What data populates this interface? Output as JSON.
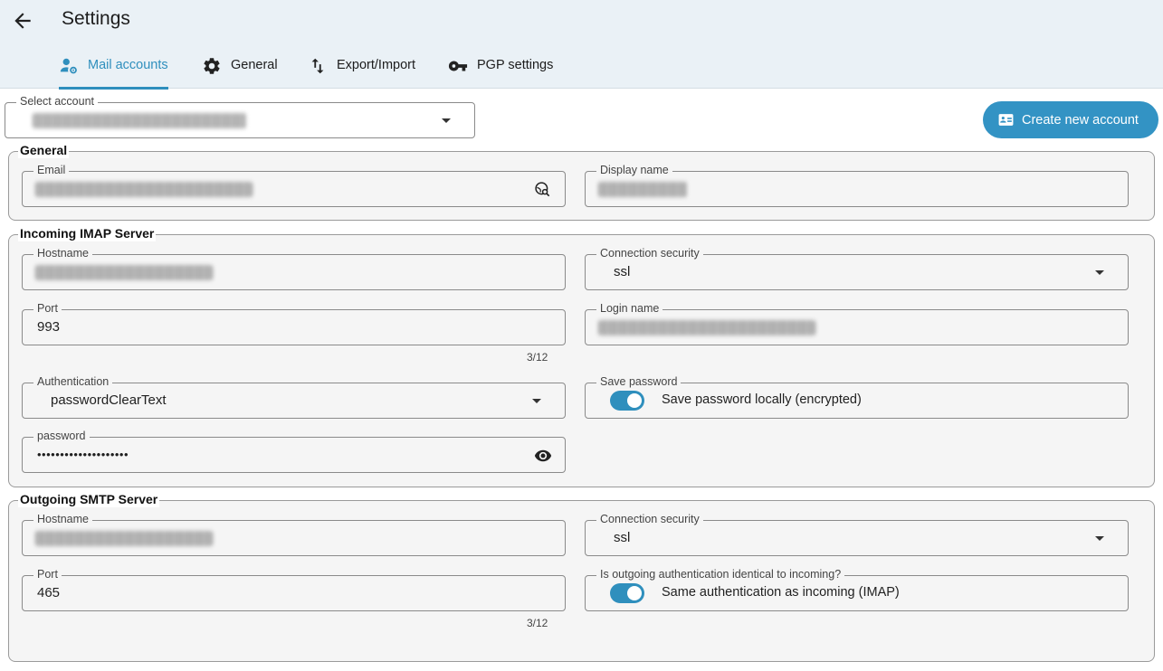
{
  "header": {
    "title": "Settings"
  },
  "tabs": [
    {
      "label": "Mail accounts",
      "icon": "manage-accounts-icon",
      "active": true
    },
    {
      "label": "General",
      "icon": "gear-icon",
      "active": false
    },
    {
      "label": "Export/Import",
      "icon": "swap-vert-icon",
      "active": false
    },
    {
      "label": "PGP settings",
      "icon": "key-icon",
      "active": false
    }
  ],
  "account_select": {
    "label": "Select account"
  },
  "create_button": {
    "label": "Create new account",
    "icon": "contact-card-icon"
  },
  "general": {
    "title": "General",
    "email_label": "Email",
    "display_name_label": "Display name"
  },
  "imap": {
    "title": "Incoming IMAP Server",
    "hostname_label": "Hostname",
    "security_label": "Connection security",
    "security_value": "ssl",
    "port_label": "Port",
    "port_value": "993",
    "port_counter": "3/12",
    "login_label": "Login name",
    "auth_label": "Authentication",
    "auth_value": "passwordClearText",
    "save_pw_label": "Save password",
    "save_pw_toggle_label": "Save password locally (encrypted)",
    "save_pw_enabled": true,
    "password_label": "password",
    "password_value": "••••••••••••••••••••"
  },
  "smtp": {
    "title": "Outgoing SMTP Server",
    "hostname_label": "Hostname",
    "security_label": "Connection security",
    "security_value": "ssl",
    "port_label": "Port",
    "port_value": "465",
    "port_counter": "3/12",
    "same_auth_label": "Is outgoing authentication identical to incoming?",
    "same_auth_toggle_label": "Same authentication as incoming (IMAP)",
    "same_auth_enabled": true
  },
  "colors": {
    "accent": "#2f8fbd",
    "header_bg": "#eaf1f6",
    "section_bg": "#f5f5f5"
  }
}
